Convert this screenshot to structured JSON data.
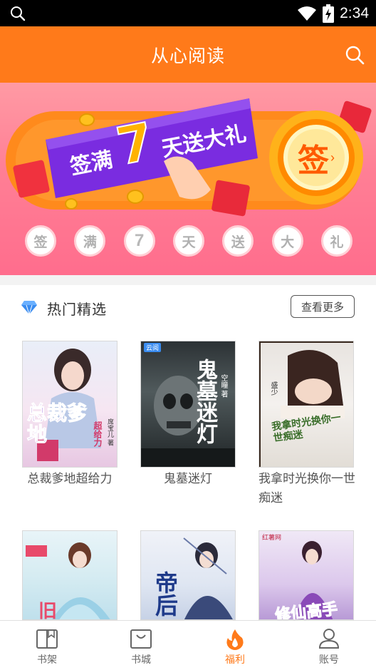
{
  "status_bar": {
    "time": "2:34",
    "icons": [
      "search-icon",
      "wifi-icon",
      "battery-icon"
    ]
  },
  "header": {
    "title": "从心阅读",
    "search_icon": "search-icon"
  },
  "banner": {
    "headline_part1": "签满",
    "headline_number": "7",
    "headline_part2": "天送大礼",
    "sign_button": "签",
    "sign_days": [
      "签",
      "满",
      "7",
      "天",
      "送",
      "大",
      "礼"
    ]
  },
  "section": {
    "icon": "diamond-icon",
    "title": "热门精选",
    "more_label": "查看更多"
  },
  "books": [
    {
      "title": "总裁爹地超给力",
      "cover_text": "总裁爹地",
      "cover_sub": "超给力",
      "author": "席宝儿 著"
    },
    {
      "title": "鬼墓迷灯",
      "cover_text": "鬼墓迷灯",
      "cover_sub": "",
      "author": "空瞳 著"
    },
    {
      "title": "我拿时光换你一世痴迷",
      "cover_text": "我拿时光换你一世痴迷",
      "cover_sub": "",
      "author": "盛少"
    },
    {
      "title": "",
      "cover_text": "",
      "cover_sub": "",
      "author": ""
    },
    {
      "title": "",
      "cover_text": "帝后",
      "cover_sub": "",
      "author": ""
    },
    {
      "title": "",
      "cover_text": "修仙高手",
      "cover_sub": "",
      "author": ""
    }
  ],
  "tabs": [
    {
      "label": "书架",
      "icon": "bookshelf-icon",
      "active": false
    },
    {
      "label": "书城",
      "icon": "bookstore-icon",
      "active": false
    },
    {
      "label": "福利",
      "icon": "flame-icon",
      "active": true
    },
    {
      "label": "账号",
      "icon": "user-icon",
      "active": false
    }
  ],
  "colors": {
    "accent": "#ff7a1a",
    "banner_pink": "#ff7f95",
    "banner_purple": "#7a2ce0"
  }
}
